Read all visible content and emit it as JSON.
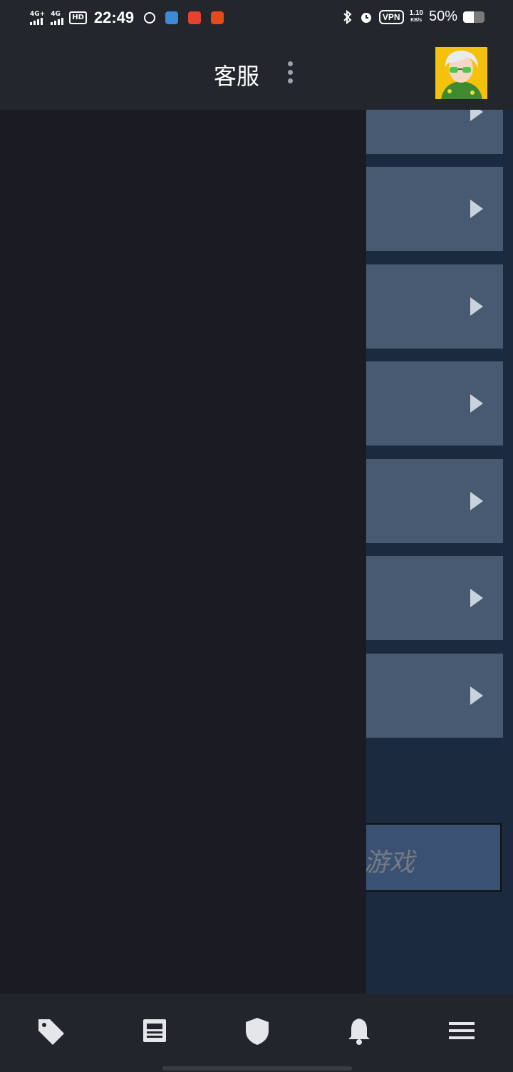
{
  "status_bar": {
    "net1": "4G+",
    "net2": "4G",
    "hd": "HD",
    "time": "22:49",
    "vpn": "VPN",
    "speed_value": "1.10",
    "speed_unit": "KB/s",
    "battery": "50%",
    "battery_level": 0.5
  },
  "header": {
    "title": "客服"
  },
  "content": {
    "rows": [
      "",
      "",
      "",
      "",
      "",
      "",
      ""
    ],
    "game_button_label": "游戏"
  },
  "bottom_nav": {
    "items": [
      "tag-icon",
      "news-icon",
      "shield-icon",
      "bell-icon",
      "menu-icon"
    ]
  },
  "colors": {
    "header_bg": "#23262c",
    "drawer_bg": "#1a1b23",
    "row_bg": "#485a71",
    "content_bg": "#1c2a3f"
  }
}
